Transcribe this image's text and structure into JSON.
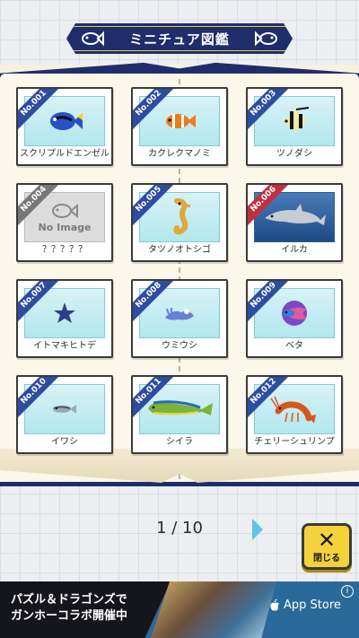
{
  "header": {
    "title": "ミニチュア図鑑"
  },
  "cards": [
    {
      "number": "No.001",
      "name": "スクリプルドエンゼル",
      "ribbon": "blue",
      "bg": "light",
      "icon": "blue-tang-fish"
    },
    {
      "number": "No.002",
      "name": "カクレクマノミ",
      "ribbon": "blue",
      "bg": "light",
      "icon": "clownfish"
    },
    {
      "number": "No.003",
      "name": "ツノダシ",
      "ribbon": "blue",
      "bg": "light",
      "icon": "moorish-idol-fish"
    },
    {
      "number": "No.004",
      "name": "？？？？？",
      "ribbon": "gray",
      "bg": "locked",
      "icon": "no-image",
      "image_text": "No Image"
    },
    {
      "number": "No.005",
      "name": "タツノオトシゴ",
      "ribbon": "blue",
      "bg": "light",
      "icon": "seahorse"
    },
    {
      "number": "No.006",
      "name": "イルカ",
      "ribbon": "red",
      "bg": "dark",
      "icon": "dolphin"
    },
    {
      "number": "No.007",
      "name": "イトマキヒトデ",
      "ribbon": "blue",
      "bg": "light",
      "icon": "starfish"
    },
    {
      "number": "No.008",
      "name": "ウミウシ",
      "ribbon": "blue",
      "bg": "light",
      "icon": "sea-slug"
    },
    {
      "number": "No.009",
      "name": "ベタ",
      "ribbon": "blue",
      "bg": "light",
      "icon": "betta-fish"
    },
    {
      "number": "No.010",
      "name": "イワシ",
      "ribbon": "blue",
      "bg": "light",
      "icon": "sardine"
    },
    {
      "number": "No.011",
      "name": "シイラ",
      "ribbon": "blue",
      "bg": "light",
      "icon": "mahi-mahi"
    },
    {
      "number": "No.012",
      "name": "チェリーシュリンプ",
      "ribbon": "blue",
      "bg": "light",
      "icon": "shrimp"
    }
  ],
  "pager": {
    "text": "1 / 10"
  },
  "close_button": {
    "label": "閉じる",
    "glyph": "✕"
  },
  "ad": {
    "line1": "パズル＆ドラゴンズで",
    "line2": "ガンホーコラボ開催中",
    "store_label": "App Store",
    "info_glyph": "i"
  },
  "colors": {
    "navy": "#1f2d6b",
    "ribbon_blue": "#2d4d9e",
    "ribbon_gray": "#777777",
    "ribbon_red": "#c0303f",
    "close_yellow": "#f4d23c",
    "arrow_cyan": "#5bc7e0"
  }
}
